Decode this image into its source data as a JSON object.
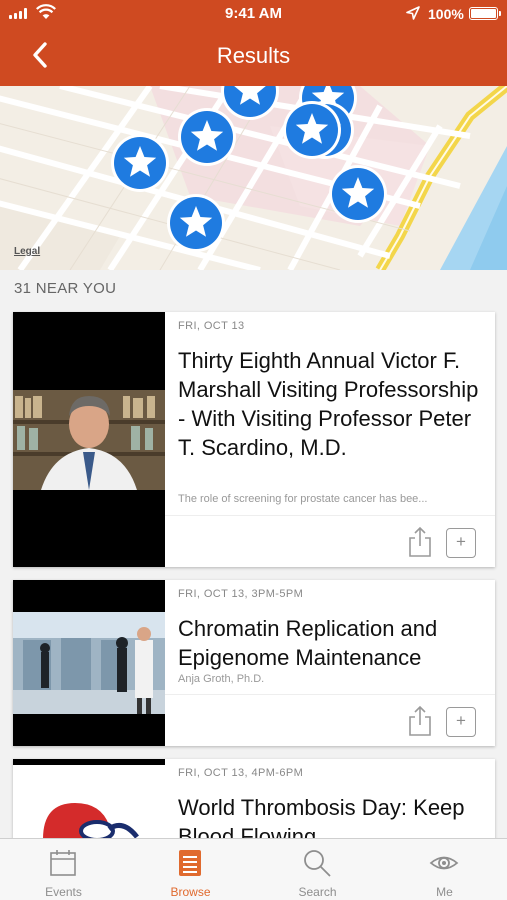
{
  "status_bar": {
    "time": "9:41 AM",
    "battery": "100%"
  },
  "header": {
    "title": "Results"
  },
  "map": {
    "legal_label": "Legal"
  },
  "section": {
    "heading": "31 NEAR YOU"
  },
  "events": [
    {
      "date": "FRI, OCT 13",
      "title": "Thirty Eighth Annual Victor F. Marshall Visiting Professorship - With Visiting Professor Peter T. Scardino, M.D.",
      "subtitle": "The role of screening for prostate cancer has bee..."
    },
    {
      "date": "FRI, OCT 13, 3PM-5PM",
      "title": "Chromatin Replication and Epigenome Maintenance",
      "subtitle": "Anja Groth, Ph.D."
    },
    {
      "date": "FRI, OCT 13, 4PM-6PM",
      "title": "World Thrombosis Day: Keep Blood Flowing",
      "subtitle": ""
    }
  ],
  "card_actions": {
    "add_label": "+"
  },
  "tabs": [
    {
      "label": "Events",
      "icon": "calendar-icon"
    },
    {
      "label": "Browse",
      "icon": "browse-icon",
      "active": true
    },
    {
      "label": "Search",
      "icon": "search-icon"
    },
    {
      "label": "Me",
      "icon": "eye-icon"
    }
  ],
  "colors": {
    "accent": "#cf4a21",
    "active_tab": "#e06a2e",
    "pin": "#1f7be0"
  }
}
